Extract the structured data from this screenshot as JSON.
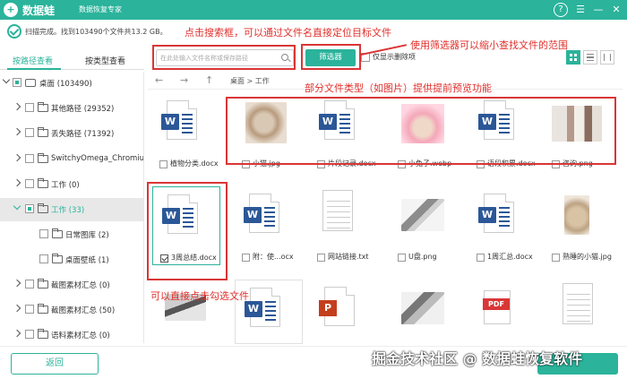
{
  "titlebar": {
    "logo_char": "+",
    "app_name": "数据蛙",
    "subtitle": "数据恢复专家",
    "help_icon": "?",
    "menu_icon": "☰",
    "min_icon": "—",
    "close_icon": "✕"
  },
  "status": {
    "text": "扫描完成。找到103490个文件共13.2 GB。"
  },
  "annotations": {
    "search_tip": "点击搜索框，可以通过文件名直接定位目标文件",
    "filter_tip": "使用筛选器可以缩小查找文件的范围",
    "preview_tip": "部分文件类型（如图片）提供提前预览功能",
    "select_tip": "可以直接点击勾选文件"
  },
  "tabs": [
    {
      "label": "按路径查看"
    },
    {
      "label": "按类型查看"
    }
  ],
  "sidebar": {
    "items": [
      {
        "label": "桌面 (103490)",
        "level": 0
      },
      {
        "label": "其他路径 (29352)",
        "level": 1
      },
      {
        "label": "丢失路径 (71392)",
        "level": 1
      },
      {
        "label": "SwitchyOmega_Chromium",
        "level": 1
      },
      {
        "label": "工作 (0)",
        "level": 1
      },
      {
        "label": "工作 (33)",
        "level": 1
      },
      {
        "label": "日常图库 (2)",
        "level": 2
      },
      {
        "label": "桌面壁纸 (1)",
        "level": 2
      },
      {
        "label": "截图素材汇总 (0)",
        "level": 1
      },
      {
        "label": "截图素材汇总 (50)",
        "level": 1
      },
      {
        "label": "语料素材汇总 (0)",
        "level": 1
      }
    ]
  },
  "toolbar": {
    "search_placeholder": "在此处输入文件名称或保存路径",
    "filter_label": "筛选器",
    "show_deleted_label": "仅显示删除项"
  },
  "nav": {
    "back": "←",
    "forward": "→",
    "up": "↑",
    "breadcrumb": "桌面 > 工作"
  },
  "files": {
    "row1": [
      "植物分类.docx",
      "小猫.jpg",
      "片段记录.docx",
      "小兔子.webp",
      "语段积累.docx",
      "咨询.png"
    ],
    "row2": [
      "3周总结.docx",
      "附：使...ocx",
      "网站链接.txt",
      "U盘.png",
      "1周汇总.docx",
      "熟睡的小猫.jpg"
    ]
  },
  "bottom": {
    "back_label": "返回"
  },
  "watermark": "掘金技术社区 @ 数据蛙恢复软件",
  "colors": {
    "accent": "#2bb39b",
    "annotation": "#e0302c",
    "word_blue": "#2b5797"
  }
}
